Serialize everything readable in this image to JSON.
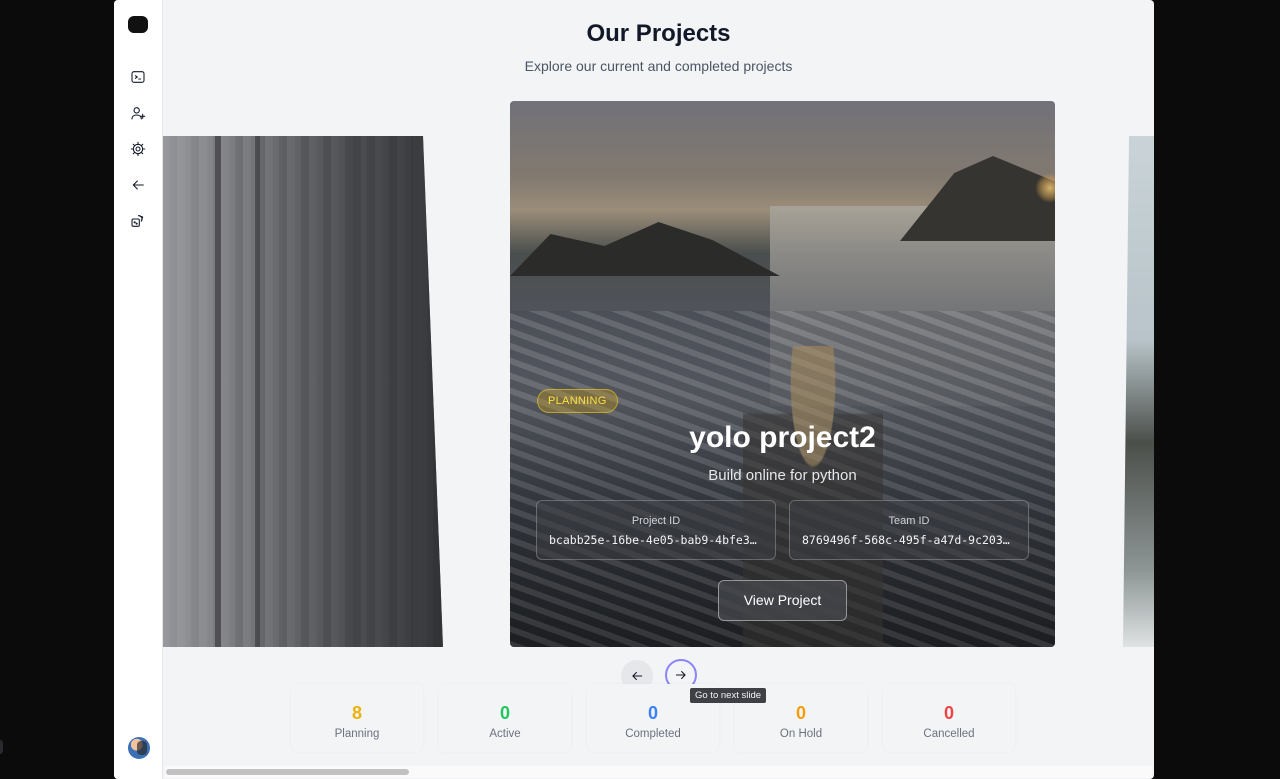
{
  "header": {
    "title": "Our Projects",
    "subtitle": "Explore our current and completed projects"
  },
  "sidebar": {
    "items": [
      {
        "icon": "terminal-icon"
      },
      {
        "icon": "user-plus-icon"
      },
      {
        "icon": "gear-icon"
      },
      {
        "icon": "arrow-left-icon"
      },
      {
        "icon": "dice-icon"
      }
    ]
  },
  "card": {
    "status": "PLANNING",
    "title": "yolo project2",
    "description": "Build online for python",
    "project_id_label": "Project ID",
    "project_id": "bcabb25e-16be-4e05-bab9-4bfe38…",
    "team_id_label": "Team ID",
    "team_id": "8769496f-568c-495f-a47d-9c2037…",
    "button_label": "View Project"
  },
  "carousel": {
    "tooltip": "Go to next slide"
  },
  "stats": [
    {
      "value": "8",
      "label": "Planning",
      "color": "#eab308"
    },
    {
      "value": "0",
      "label": "Active",
      "color": "#22c55e"
    },
    {
      "value": "0",
      "label": "Completed",
      "color": "#3b82f6"
    },
    {
      "value": "0",
      "label": "On Hold",
      "color": "#f59e0b"
    },
    {
      "value": "0",
      "label": "Cancelled",
      "color": "#ef4444"
    }
  ]
}
